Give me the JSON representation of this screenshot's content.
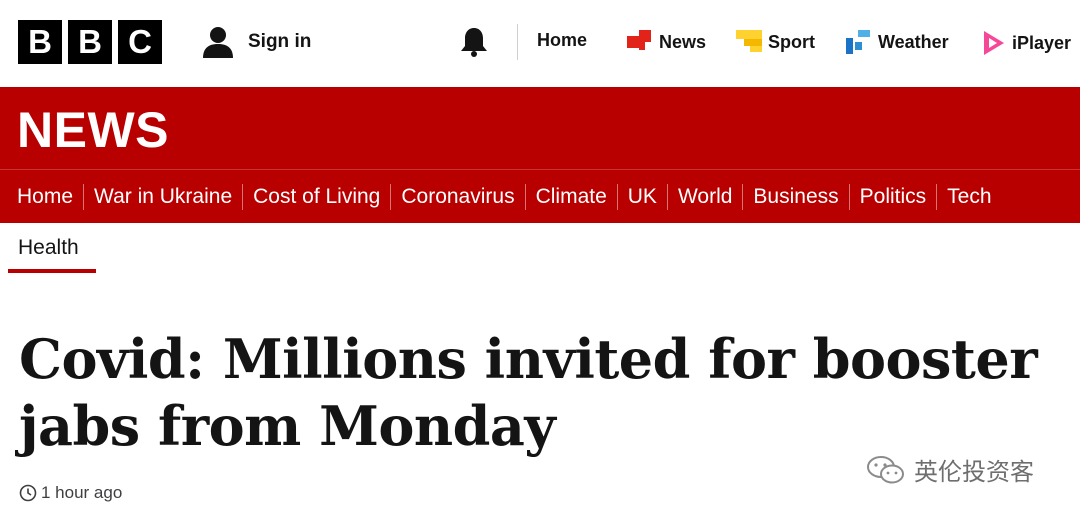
{
  "brand": {
    "letters": [
      "B",
      "B",
      "C"
    ]
  },
  "header": {
    "signin_label": "Sign in",
    "nav": [
      {
        "label": "Home",
        "icon": "none"
      },
      {
        "label": "News",
        "icon": "news-icon",
        "color": "#e2231a"
      },
      {
        "label": "Sport",
        "icon": "sport-icon",
        "color": "#ffd230"
      },
      {
        "label": "Weather",
        "icon": "weather-icon",
        "color": "#2b8fd2"
      },
      {
        "label": "iPlayer",
        "icon": "iplayer-icon",
        "color": "#f54997"
      }
    ]
  },
  "banner": {
    "title": "NEWS",
    "color": "#b80000"
  },
  "section_nav": [
    "Home",
    "War in Ukraine",
    "Cost of Living",
    "Coronavirus",
    "Climate",
    "UK",
    "World",
    "Business",
    "Politics",
    "Tech"
  ],
  "subnav": {
    "active": "Health"
  },
  "article": {
    "headline_line1": "Covid: Millions invited for booster",
    "headline_line2": "jabs from Monday",
    "timestamp": "1 hour ago"
  },
  "watermark": {
    "text": "英伦投资客"
  }
}
